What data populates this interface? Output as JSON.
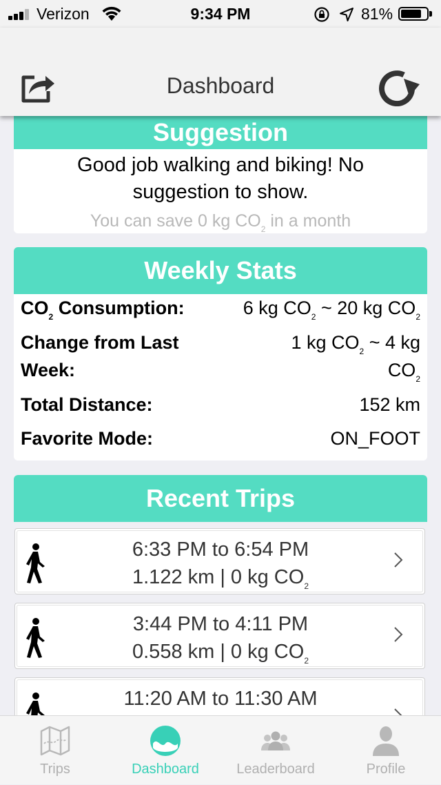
{
  "status_bar": {
    "carrier": "Verizon",
    "time": "9:34 PM",
    "battery_percent": "81%",
    "battery_level": 0.81
  },
  "nav": {
    "title": "Dashboard",
    "left_icon": "share-icon",
    "right_icon": "refresh-icon"
  },
  "suggestion": {
    "header": "Suggestion",
    "text": "Good job walking and biking! No suggestion to show.",
    "save_prefix": "You can save 0 kg CO",
    "save_sub": "2",
    "save_suffix": " in a month"
  },
  "weekly_stats": {
    "header": "Weekly Stats",
    "co2_label_prefix": "CO",
    "co2_label_sub": "2",
    "co2_label_suffix": " Consumption:",
    "co2_value_a": "6 kg CO",
    "co2_value_b": " ~ 20 kg CO",
    "co2_sub": "2",
    "change_label_line1": "Change from Last",
    "change_label_line2": "Week:",
    "change_value_a": "1 kg CO",
    "change_value_b": " ~ 4 kg",
    "change_value_c": "CO",
    "change_sub": "2",
    "distance_label": "Total Distance:",
    "distance_value": "152 km",
    "mode_label": "Favorite Mode:",
    "mode_value": "ON_FOOT"
  },
  "recent_trips": {
    "header": "Recent Trips",
    "co2_sub": "2",
    "items": [
      {
        "time": "6:33 PM to 6:54 PM",
        "detail": "1.122 km | 0 kg CO",
        "icon": "walking-icon"
      },
      {
        "time": "3:44 PM to 4:11 PM",
        "detail": "0.558 km | 0 kg CO",
        "icon": "walking-icon"
      },
      {
        "time": "11:20 AM to 11:30 AM",
        "detail": "",
        "icon": "walking-icon"
      }
    ]
  },
  "tabs": [
    {
      "label": "Trips",
      "icon": "map-icon",
      "active": false
    },
    {
      "label": "Dashboard",
      "icon": "dashboard-icon",
      "active": true
    },
    {
      "label": "Leaderboard",
      "icon": "group-icon",
      "active": false
    },
    {
      "label": "Profile",
      "icon": "profile-icon",
      "active": false
    }
  ],
  "colors": {
    "accent": "#54dcc2",
    "tab_active": "#38d0b7",
    "tab_inactive": "#b0b0b0"
  }
}
